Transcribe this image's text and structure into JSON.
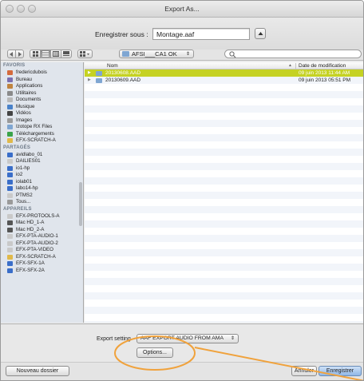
{
  "window": {
    "title": "Export As..."
  },
  "save_as": {
    "label": "Enregistrer sous :",
    "value": "Montage.aaf"
  },
  "toolbar": {
    "location": "AFSI___CA1 OK",
    "search_value": ""
  },
  "sidebar": {
    "sections": [
      {
        "title": "FAVORIS",
        "items": [
          {
            "label": "fredericdubois",
            "icon": "home-icon",
            "color": "#d46a3c"
          },
          {
            "label": "Bureau",
            "icon": "desktop-icon",
            "color": "#7a6fb0"
          },
          {
            "label": "Applications",
            "icon": "applications-icon",
            "color": "#c0843f"
          },
          {
            "label": "Utilitaires",
            "icon": "utilities-icon",
            "color": "#8a8a8a"
          },
          {
            "label": "Documents",
            "icon": "documents-icon",
            "color": "#b8b8b8"
          },
          {
            "label": "Musique",
            "icon": "music-icon",
            "color": "#4a82c9"
          },
          {
            "label": "Vidéos",
            "icon": "movies-icon",
            "color": "#444"
          },
          {
            "label": "Images",
            "icon": "pictures-icon",
            "color": "#9a9a9a"
          },
          {
            "label": "Izotope RX Files",
            "icon": "folder-icon",
            "color": "#7fa6d2"
          },
          {
            "label": "Téléchargements",
            "icon": "downloads-icon",
            "color": "#3aa34a"
          },
          {
            "label": "EFX-SCRATCH-A",
            "icon": "drive-icon",
            "color": "#e0b94a"
          }
        ]
      },
      {
        "title": "PARTAGÉS",
        "items": [
          {
            "label": "avidlabo_01",
            "icon": "server-icon",
            "color": "#3a6ec9"
          },
          {
            "label": "DAILIES01",
            "icon": "server-icon",
            "color": "#c9c9c9"
          },
          {
            "label": "io1-hp",
            "icon": "server-icon",
            "color": "#3a6ec9"
          },
          {
            "label": "io2",
            "icon": "server-icon",
            "color": "#3a6ec9"
          },
          {
            "label": "iolab01",
            "icon": "server-icon",
            "color": "#3a6ec9"
          },
          {
            "label": "labo14-hp",
            "icon": "server-icon",
            "color": "#3a6ec9"
          },
          {
            "label": "PTMS2",
            "icon": "server-icon",
            "color": "#c9c9c9"
          },
          {
            "label": "Tous...",
            "icon": "network-icon",
            "color": "#9a9a9a"
          }
        ]
      },
      {
        "title": "APPAREILS",
        "items": [
          {
            "label": "EFX-PROTOOLS-A",
            "icon": "disk-icon",
            "color": "#c9c9c9"
          },
          {
            "label": "Mac HD_1-A",
            "icon": "disk-icon",
            "color": "#555"
          },
          {
            "label": "Mac HD_2-A",
            "icon": "disk-icon",
            "color": "#555"
          },
          {
            "label": "EFX-PTA-AUDIO-1",
            "icon": "disk-icon",
            "color": "#c9c9c9"
          },
          {
            "label": "EFX-PTA-AUDIO-2",
            "icon": "disk-icon",
            "color": "#c9c9c9"
          },
          {
            "label": "EFX-PTA-VIDEO",
            "icon": "disk-icon",
            "color": "#c9c9c9"
          },
          {
            "label": "EFX-SCRATCH-A",
            "icon": "disk-icon",
            "color": "#e0b94a"
          },
          {
            "label": "EFX-SFX-1A",
            "icon": "disk-icon",
            "color": "#3a6ec9"
          },
          {
            "label": "EFX-SFX-2A",
            "icon": "disk-icon",
            "color": "#3a6ec9"
          }
        ]
      }
    ]
  },
  "file_list": {
    "columns": {
      "name": "Nom",
      "date": "Date de modification"
    },
    "rows": [
      {
        "name": "20130608.AAD",
        "date": "09 juin 2013 11:44 AM",
        "selected": true
      },
      {
        "name": "20130609.AAD",
        "date": "09 juin 2013 05:51 PM",
        "selected": false
      }
    ]
  },
  "export_setting": {
    "label": "Export setting",
    "value": "AAF EXPORT AUDIO FROM AMA",
    "options_button": "Options..."
  },
  "buttons": {
    "new_folder": "Nouveau dossier",
    "cancel": "Annuler",
    "save": "Enregistrer"
  },
  "colors": {
    "selection": "#c5d223",
    "annotation": "#f0a23c"
  }
}
